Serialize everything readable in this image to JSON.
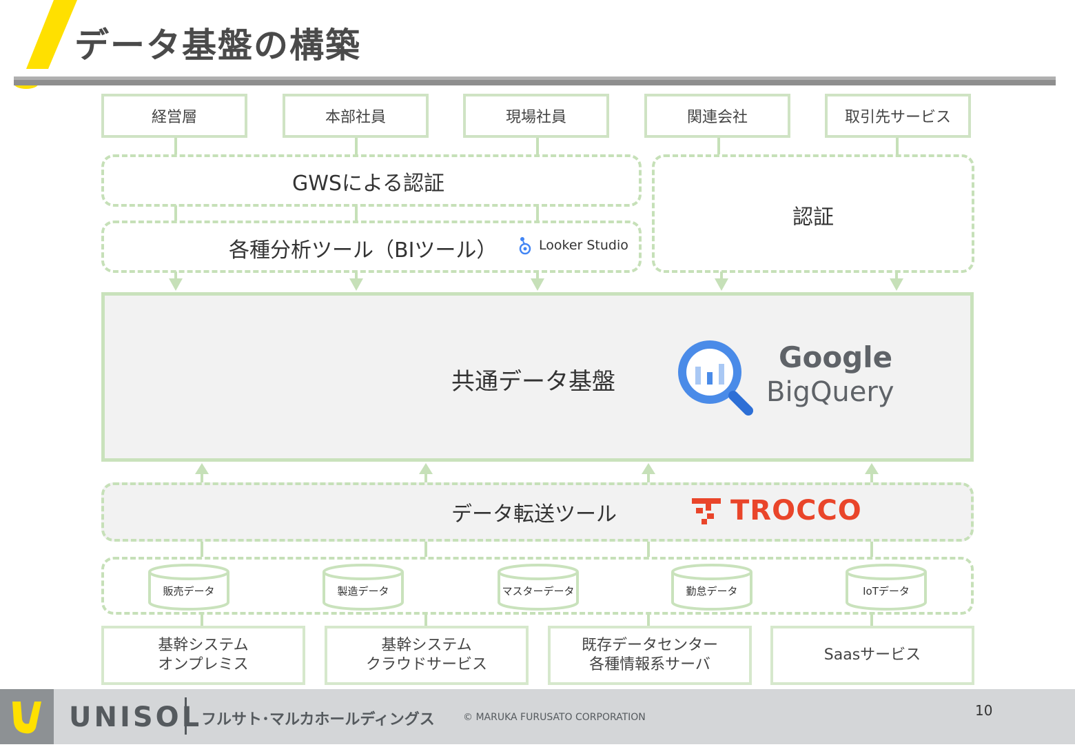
{
  "title": "データ基盤の構築",
  "users": [
    "経営層",
    "本部社員",
    "現場社員",
    "関連会社",
    "取引先サービス"
  ],
  "auth_gws": "GWSによる認証",
  "auth_other": "認証",
  "bi_tools": "各種分析ツール（BIツール）",
  "looker_logo": "Looker Studio",
  "platform": "共通データ基盤",
  "bigquery_logo": {
    "line1": "Google",
    "line2": "BigQuery"
  },
  "transfer": "データ転送ツール",
  "trocco_logo": "TROCCO",
  "databases": [
    "販売データ",
    "製造データ",
    "マスターデータ",
    "勤怠データ",
    "IoTデータ"
  ],
  "sources": [
    {
      "line1": "基幹システム",
      "line2": "オンプレミス"
    },
    {
      "line1": "基幹システム",
      "line2": "クラウドサービス"
    },
    {
      "line1": "既存データセンター",
      "line2": "各種情報系サーバ"
    },
    {
      "line1": "Saasサービス",
      "line2": ""
    }
  ],
  "footer": {
    "brand": "UNISOL",
    "company": "フルサト･マルカホールディングス",
    "copyright": "© MARUKA FURUSATO CORPORATION",
    "page": "10"
  },
  "colors": {
    "accent": "#ffe000",
    "line_green": "#c6e0b8",
    "trocco_red": "#e9452a",
    "bq_blue": "#4a8be8"
  }
}
